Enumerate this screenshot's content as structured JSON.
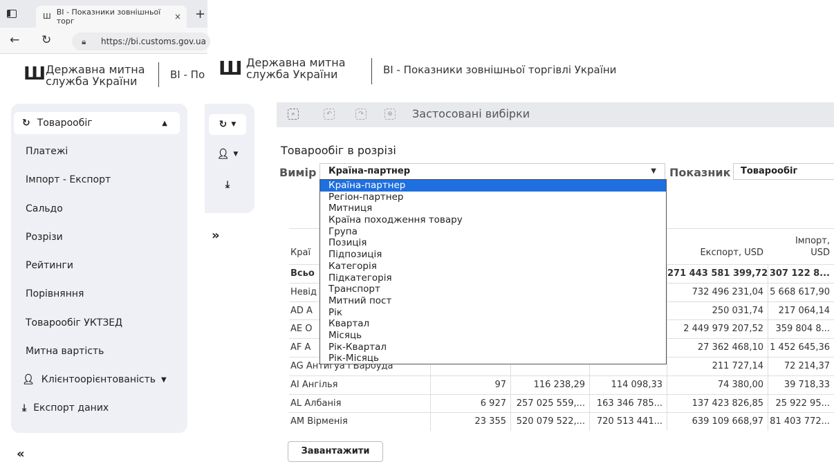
{
  "browser": {
    "tab_title": "BI - Показники зовнішньої торг",
    "tab_close": "×",
    "new_tab": "+",
    "url": "https://bi.customs.gov.ua"
  },
  "header": {
    "org_name_line1": "Державна митна",
    "org_name_line2": "служба України",
    "app_title": "BI - Показники зовнішньої торгівлі України",
    "app_title_short": "BI - По"
  },
  "sidebar": {
    "active_item": "Товарообіг",
    "items": [
      "Платежі",
      "Імпорт - Експорт",
      "Сальдо",
      "Розрізи",
      "Рейтинги",
      "Порівняння",
      "Товарообіг УКТЗЕД",
      "Митна вартість"
    ],
    "client_item": "Клієнтоорієнтованість",
    "export_item": "Експорт даних",
    "collapse": "«",
    "expand": "»"
  },
  "toolbar": {
    "applied_label": "Застосовані вибірки"
  },
  "main": {
    "section_title": "Товарообіг в розрізі",
    "dimension_label": "Вимір",
    "dimension_value": "Країна-партнер",
    "indicator_label": "Показник",
    "indicator_value": "Товарообіг",
    "download_label": "Завантажити"
  },
  "dropdown": {
    "options": [
      "Країна-партнер",
      "Регіон-партнер",
      "Митниця",
      "Країна походження товару",
      "Група",
      "Позиція",
      "Підпозиція",
      "Категорія",
      "Підкатегорія",
      "Транспорт",
      "Митний пост",
      "Рік",
      "Квартал",
      "Місяць",
      "Рік-Квартал",
      "Рік-Місяць"
    ],
    "selected_index": 0
  },
  "table": {
    "headers": {
      "name": "Краї",
      "export": "Експорт, USD",
      "import_line1": "Імпорт,",
      "import_line2": "USD"
    },
    "rows": [
      {
        "name": "Всьо",
        "c1": "",
        "c2": "",
        "c3": "",
        "c4": "271 443 581 399,72",
        "c5": "307 122 8...",
        "total": true
      },
      {
        "name": "Невід",
        "c1": "",
        "c2": "",
        "c3": "",
        "c4": "732 496 231,04",
        "c5": "5 668 617,90"
      },
      {
        "name": "AD A",
        "c1": "",
        "c2": "",
        "c3": "",
        "c4": "250 031,74",
        "c5": "217 064,14"
      },
      {
        "name": "AE O",
        "c1": "",
        "c2": "",
        "c3": "",
        "c4": "2 449 979 207,52",
        "c5": "359 804 8..."
      },
      {
        "name": "AF A",
        "c1": "",
        "c2": "",
        "c3": "",
        "c4": "27 362 468,10",
        "c5": "1 452 645,36"
      },
      {
        "name": "AG Антигуа і Барбуда",
        "c1": "",
        "c2": "",
        "c3": "",
        "c4": "211 727,14",
        "c5": "72 214,37"
      },
      {
        "name": "AI Ангілья",
        "c1": "97",
        "c2": "116 238,29",
        "c3": "114 098,33",
        "c4": "74 380,00",
        "c5": "39 718,33"
      },
      {
        "name": "AL Албанія",
        "c1": "6 927",
        "c2": "257 025 559,...",
        "c3": "163 346 785...",
        "c4": "137 423 826,85",
        "c5": "25 922 95..."
      },
      {
        "name": "AM Вірменія",
        "c1": "23 355",
        "c2": "520 079 522,...",
        "c3": "720 513 441...",
        "c4": "639 109 668,97",
        "c5": "81 403 772..."
      }
    ]
  }
}
